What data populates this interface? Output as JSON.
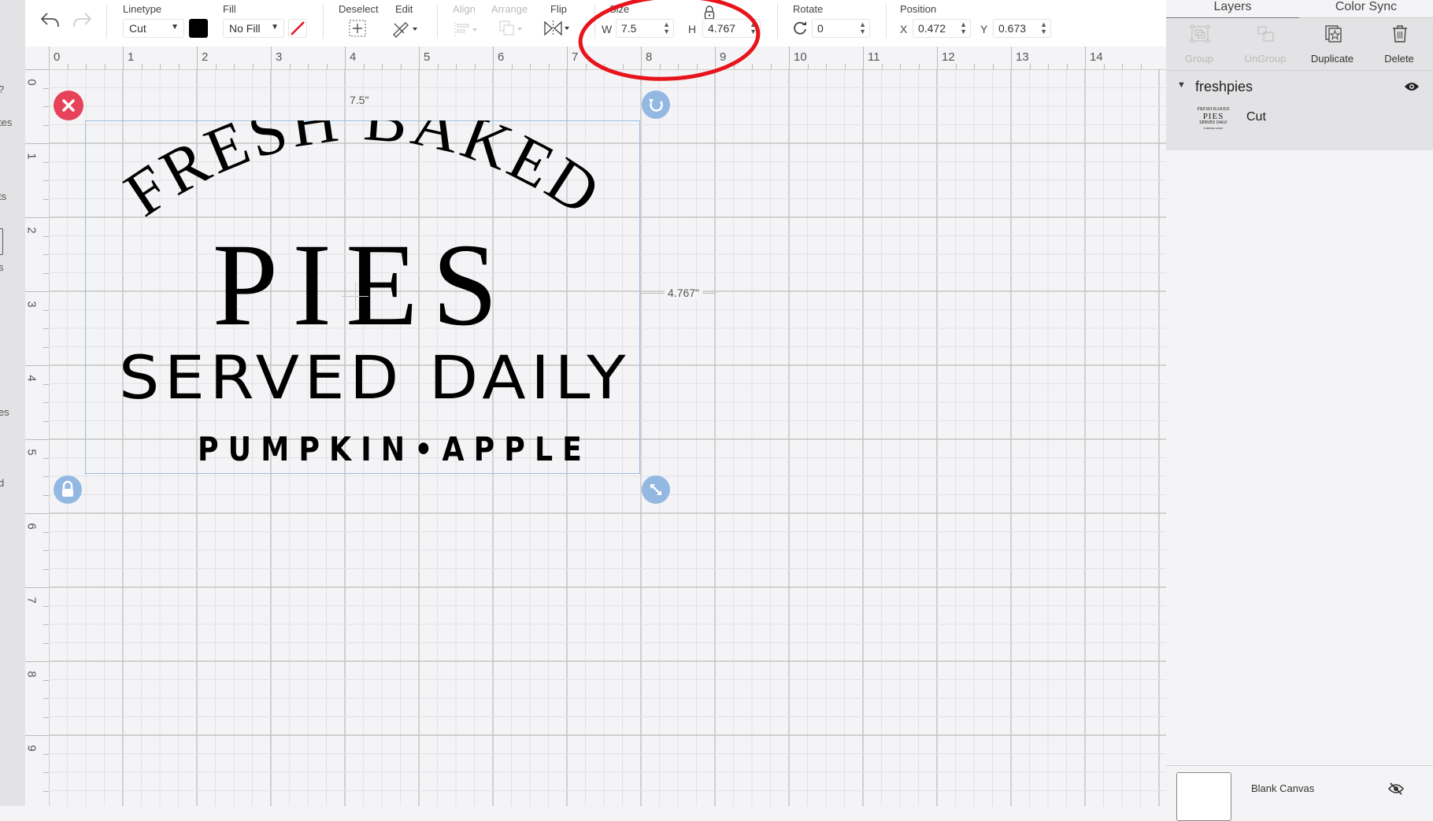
{
  "left_sidebar": {
    "fragments": [
      "?",
      "tes",
      "ts",
      "s",
      "es",
      "d"
    ]
  },
  "toolbar": {
    "undo_icon": "undo-icon",
    "redo_icon": "redo-icon",
    "linetype": {
      "label": "Linetype",
      "value": "Cut",
      "color": "#000000"
    },
    "fill": {
      "label": "Fill",
      "value": "No Fill",
      "swatch": "no-fill-slash"
    },
    "deselect_label": "Deselect",
    "edit_label": "Edit",
    "align_label": "Align",
    "arrange_label": "Arrange",
    "flip_label": "Flip",
    "size": {
      "label": "Size",
      "w_label": "W",
      "w_value": "7.5",
      "h_label": "H",
      "h_value": "4.767",
      "lock_icon": "lock-icon"
    },
    "rotate": {
      "label": "Rotate",
      "value": "0"
    },
    "position": {
      "label": "Position",
      "x_label": "X",
      "x_value": "0.472",
      "y_label": "Y",
      "y_value": "0.673"
    }
  },
  "rulers": {
    "top": [
      "0",
      "1",
      "2",
      "3",
      "4",
      "5",
      "6",
      "7",
      "8",
      "9",
      "10",
      "11",
      "12",
      "13",
      "14"
    ],
    "left": [
      "0",
      "1",
      "2",
      "3",
      "4",
      "5",
      "6",
      "7",
      "8",
      "9"
    ]
  },
  "canvas": {
    "width_label": "7.5\"",
    "height_label": "4.767\"",
    "design": {
      "line1": "FRESH BAKED",
      "line2": "PIES",
      "line3": "SERVED DAILY",
      "line4": "PUMPKIN•APPLE"
    }
  },
  "annotation": {
    "color": "#e8141c"
  },
  "right_panel": {
    "tabs": [
      {
        "label": "Layers",
        "active": true
      },
      {
        "label": "Color Sync",
        "active": false
      }
    ],
    "actions": [
      {
        "label": "Group",
        "enabled": false
      },
      {
        "label": "UnGroup",
        "enabled": false
      },
      {
        "label": "Duplicate",
        "enabled": true
      },
      {
        "label": "Delete",
        "enabled": true
      }
    ],
    "layer_group": {
      "name": "freshpies",
      "visible": true
    },
    "layer_item": {
      "label": "Cut",
      "thumb": [
        "FRESH BAKED",
        "PIES",
        "SERVED DAILY",
        "PUMPKIN•APPLE"
      ]
    },
    "blank_canvas": {
      "label": "Blank Canvas",
      "visible": false
    }
  }
}
